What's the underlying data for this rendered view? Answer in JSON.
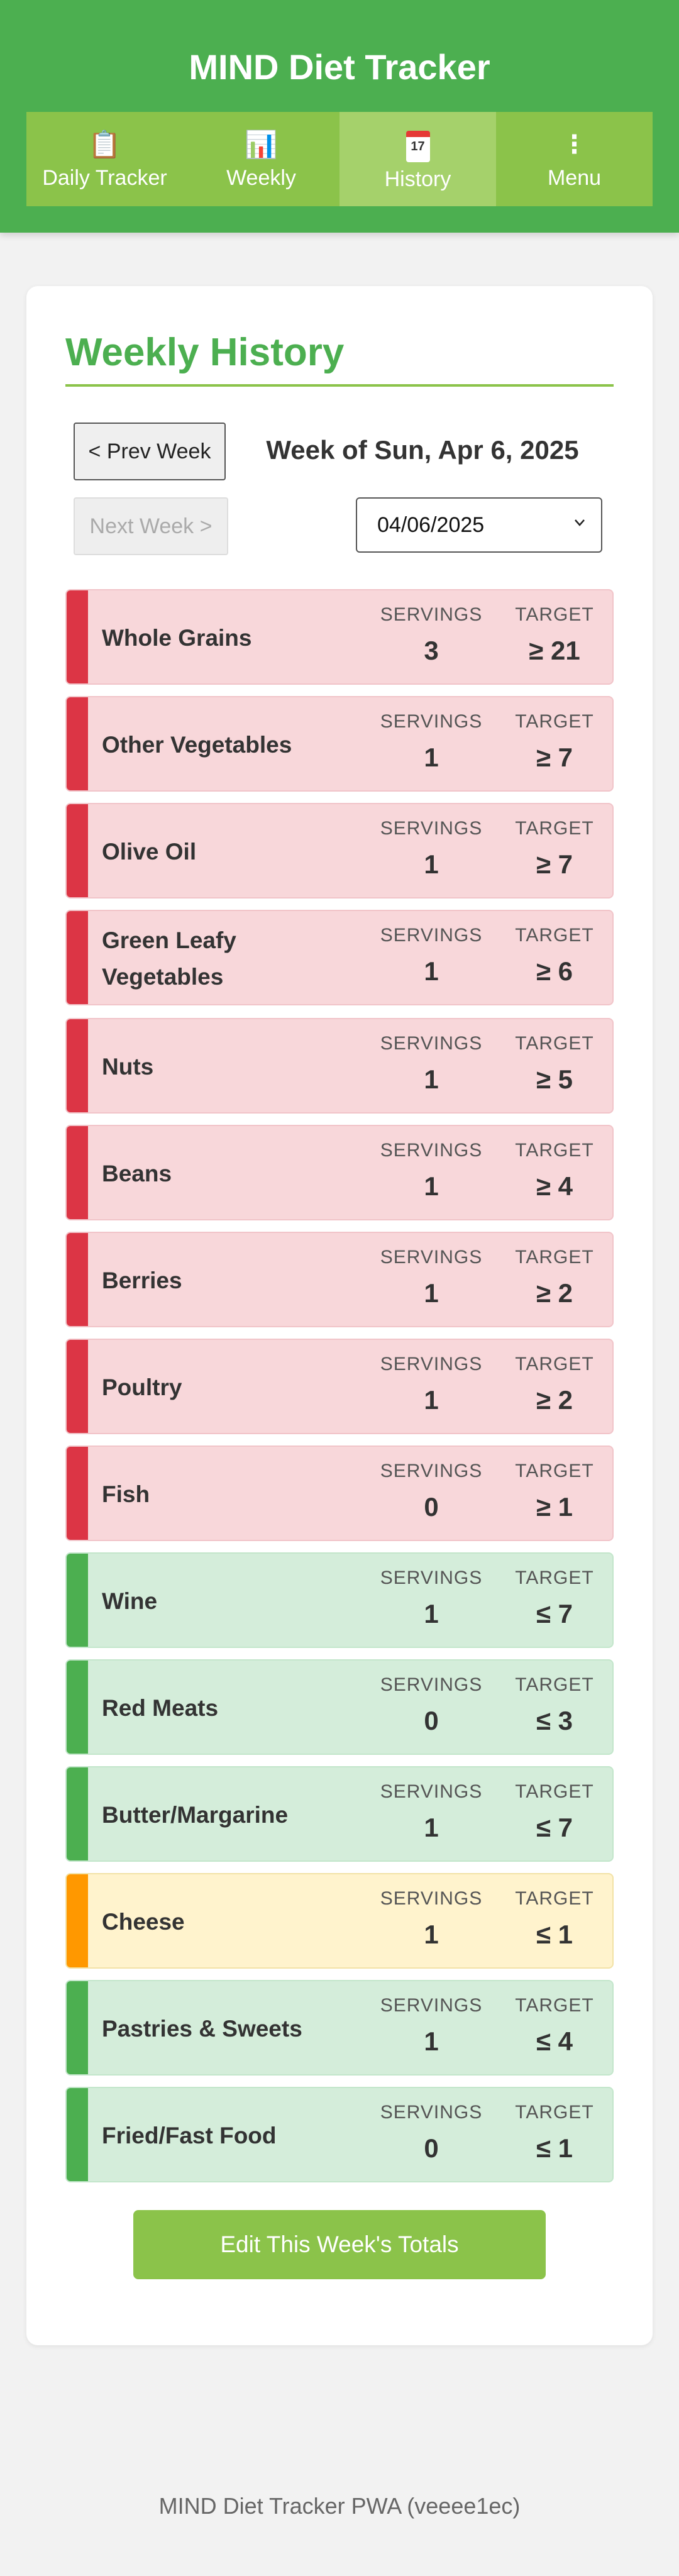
{
  "app": {
    "title": "MIND Diet Tracker"
  },
  "nav": {
    "items": [
      {
        "label": "Daily Tracker",
        "icon": "clipboard-icon",
        "glyph": "📋"
      },
      {
        "label": "Weekly",
        "icon": "bar-chart-icon",
        "glyph": "📊"
      },
      {
        "label": "History",
        "icon": "calendar-icon",
        "glyph": "17",
        "active": true
      },
      {
        "label": "Menu",
        "icon": "more-vertical-icon",
        "glyph": "⋮"
      }
    ]
  },
  "history": {
    "title": "Weekly History",
    "prev_label": "< Prev Week",
    "next_label": "Next Week >",
    "week_label": "Week of Sun, Apr 6, 2025",
    "date_value": "04/06/2025",
    "col_servings": "SERVINGS",
    "col_target": "TARGET",
    "rows": [
      {
        "name": "Whole Grains",
        "servings": "3",
        "target": "≥ 21",
        "status": "bad"
      },
      {
        "name": "Other Vegetables",
        "servings": "1",
        "target": "≥ 7",
        "status": "bad"
      },
      {
        "name": "Olive Oil",
        "servings": "1",
        "target": "≥ 7",
        "status": "bad"
      },
      {
        "name": "Green Leafy Vegetables",
        "servings": "1",
        "target": "≥ 6",
        "status": "bad"
      },
      {
        "name": "Nuts",
        "servings": "1",
        "target": "≥ 5",
        "status": "bad"
      },
      {
        "name": "Beans",
        "servings": "1",
        "target": "≥ 4",
        "status": "bad"
      },
      {
        "name": "Berries",
        "servings": "1",
        "target": "≥ 2",
        "status": "bad"
      },
      {
        "name": "Poultry",
        "servings": "1",
        "target": "≥ 2",
        "status": "bad"
      },
      {
        "name": "Fish",
        "servings": "0",
        "target": "≥ 1",
        "status": "bad"
      },
      {
        "name": "Wine",
        "servings": "1",
        "target": "≤ 7",
        "status": "good"
      },
      {
        "name": "Red Meats",
        "servings": "0",
        "target": "≤ 3",
        "status": "good"
      },
      {
        "name": "Butter/Margarine",
        "servings": "1",
        "target": "≤ 7",
        "status": "good"
      },
      {
        "name": "Cheese",
        "servings": "1",
        "target": "≤ 1",
        "status": "warn"
      },
      {
        "name": "Pastries & Sweets",
        "servings": "1",
        "target": "≤ 4",
        "status": "good"
      },
      {
        "name": "Fried/Fast Food",
        "servings": "0",
        "target": "≤ 1",
        "status": "good"
      }
    ],
    "edit_label": "Edit This Week's Totals"
  },
  "colors": {
    "header": "#4caf50",
    "nav": "#8bc34a",
    "bad": "#dc3545",
    "good": "#4caf50",
    "warn": "#ff9800"
  },
  "footer": {
    "text": "MIND Diet Tracker PWA (veeee1ec)"
  }
}
